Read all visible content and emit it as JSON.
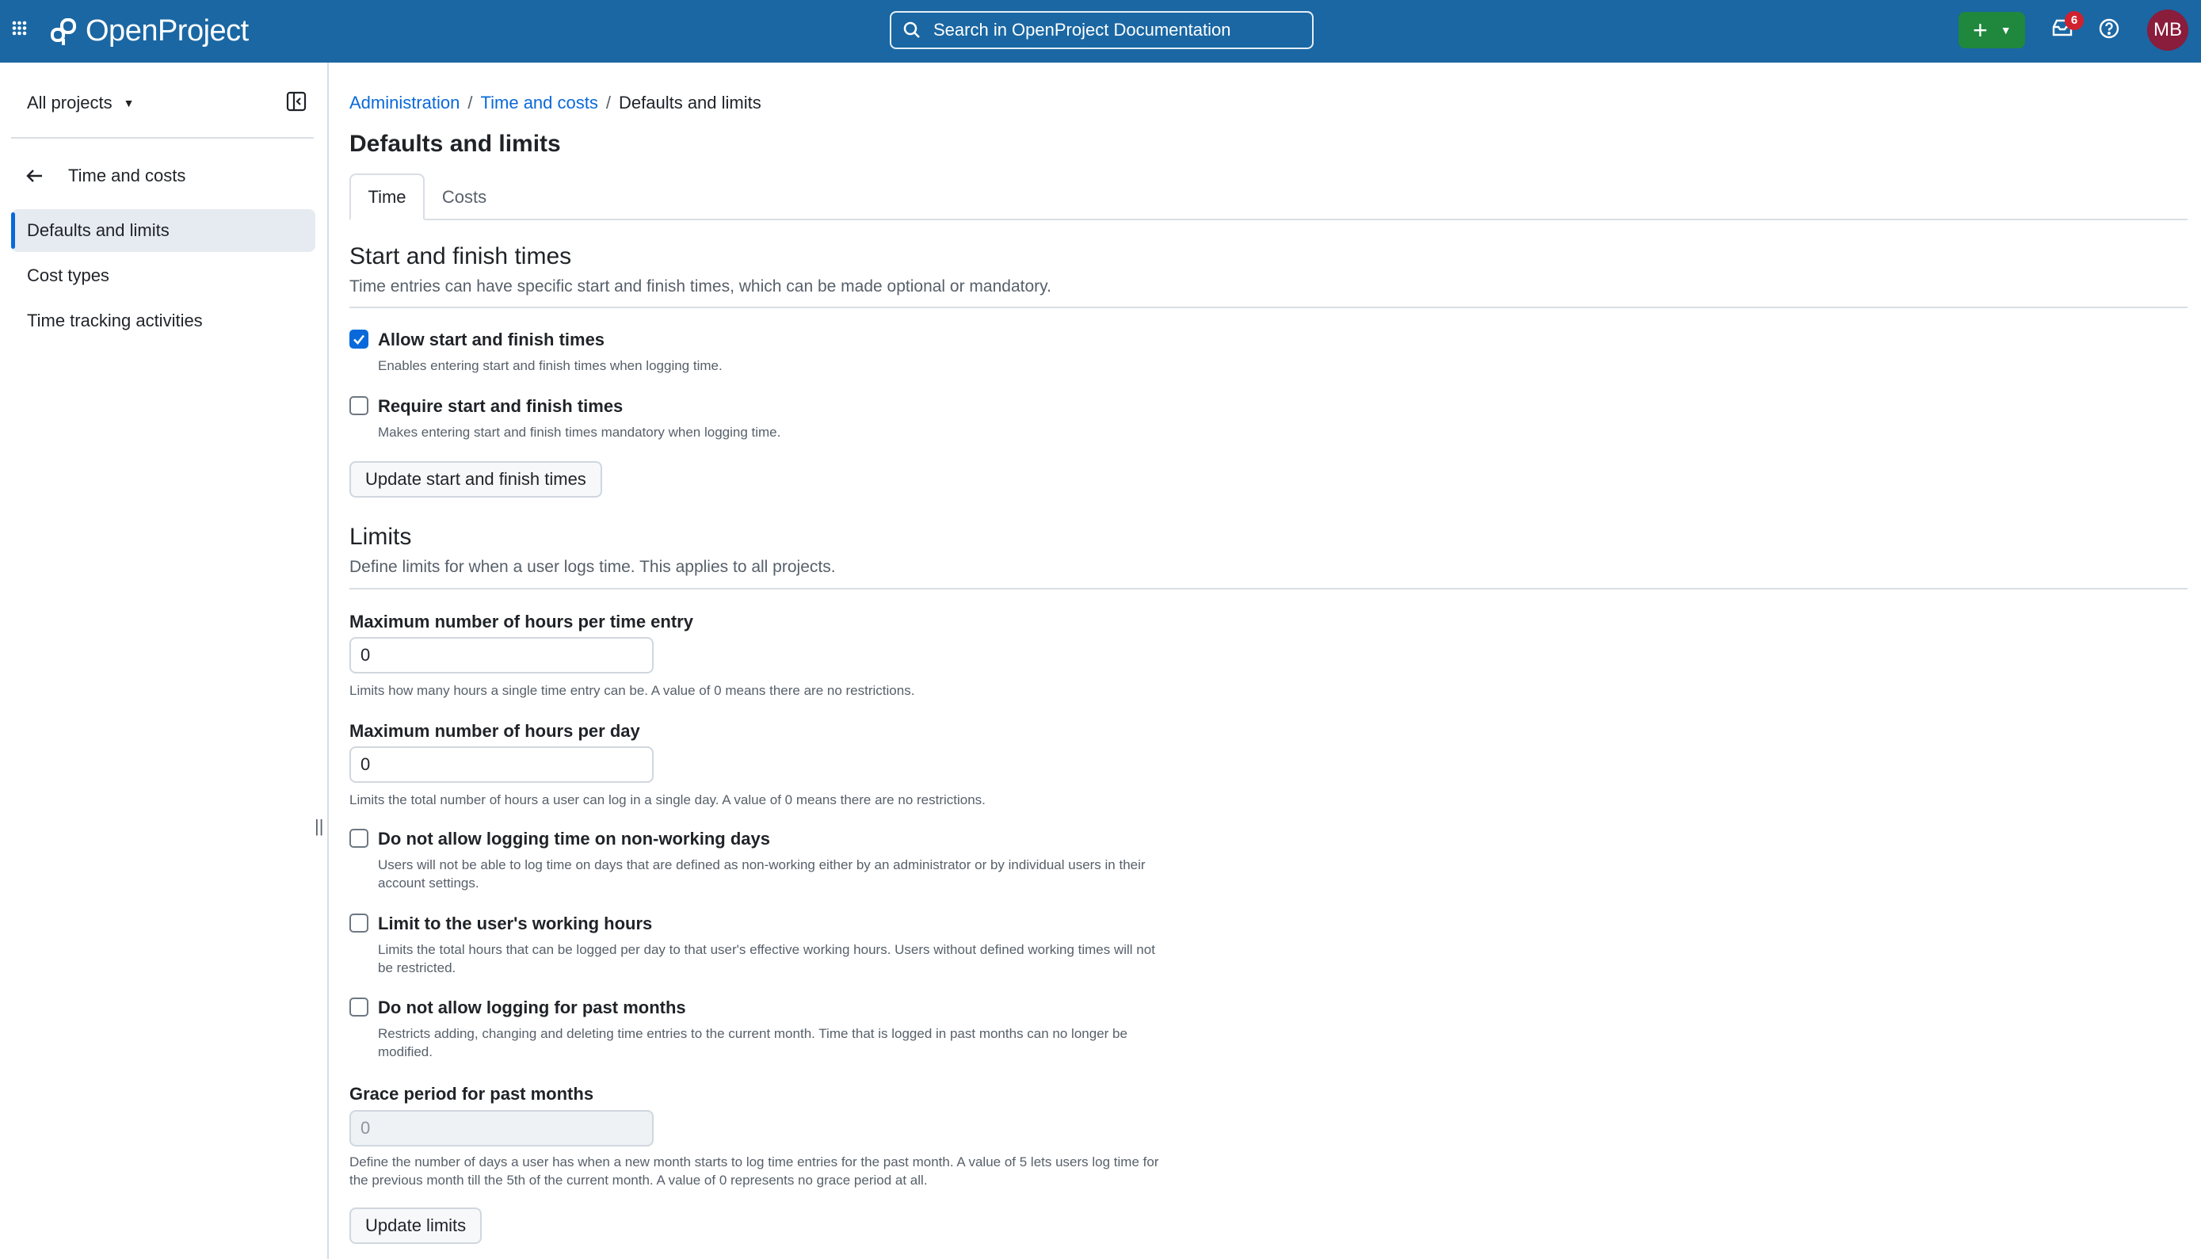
{
  "header": {
    "logo_text": "OpenProject",
    "search_placeholder": "Search in OpenProject Documentation",
    "notification_count": "6",
    "avatar_initials": "MB",
    "colors": {
      "header_bg": "#1a67a3",
      "create_btn": "#1f883d",
      "badge": "#cf222e",
      "avatar": "#8a1c3c"
    }
  },
  "sidebar": {
    "project_selector": "All projects",
    "back_label": "Time and costs",
    "items": [
      {
        "label": "Defaults and limits",
        "active": true
      },
      {
        "label": "Cost types",
        "active": false
      },
      {
        "label": "Time tracking activities",
        "active": false
      }
    ],
    "resize_handle": "||"
  },
  "breadcrumb": {
    "items": [
      "Administration",
      "Time and costs"
    ],
    "separator": "/",
    "current": "Defaults and limits"
  },
  "page_title": "Defaults and limits",
  "tabs": [
    {
      "label": "Time",
      "active": true
    },
    {
      "label": "Costs",
      "active": false
    }
  ],
  "start_finish": {
    "title": "Start and finish times",
    "description": "Time entries can have specific start and finish times, which can be made optional or mandatory.",
    "options": [
      {
        "label": "Allow start and finish times",
        "caption": "Enables entering start and finish times when logging time.",
        "checked": true
      },
      {
        "label": "Require start and finish times",
        "caption": "Makes entering start and finish times mandatory when logging time.",
        "checked": false
      }
    ],
    "submit_label": "Update start and finish times"
  },
  "limits": {
    "title": "Limits",
    "description": "Define limits for when a user logs time. This applies to all projects.",
    "max_per_entry": {
      "label": "Maximum number of hours per time entry",
      "value": "0",
      "caption": "Limits how many hours a single time entry can be. A value of 0 means there are no restrictions."
    },
    "max_per_day": {
      "label": "Maximum number of hours per day",
      "value": "0",
      "caption": "Limits the total number of hours a user can log in a single day. A value of 0 means there are no restrictions."
    },
    "options": [
      {
        "label": "Do not allow logging time on non-working days",
        "caption": "Users will not be able to log time on days that are defined as non-working either by an administrator or by individual users in their account settings.",
        "checked": false
      },
      {
        "label": "Limit to the user's working hours",
        "caption": "Limits the total hours that can be logged per day to that user's effective working hours. Users without defined working times will not be restricted.",
        "checked": false
      },
      {
        "label": "Do not allow logging for past months",
        "caption": "Restricts adding, changing and deleting time entries to the current month. Time that is logged in past months can no longer be modified.",
        "checked": false
      }
    ],
    "grace_period": {
      "label": "Grace period for past months",
      "value": "0",
      "caption": "Define the number of days a user has when a new month starts to log time entries for the past month. A value of 5 lets users log time for the previous month till the 5th of the current month. A value of 0 represents no grace period at all."
    },
    "submit_label": "Update limits"
  }
}
